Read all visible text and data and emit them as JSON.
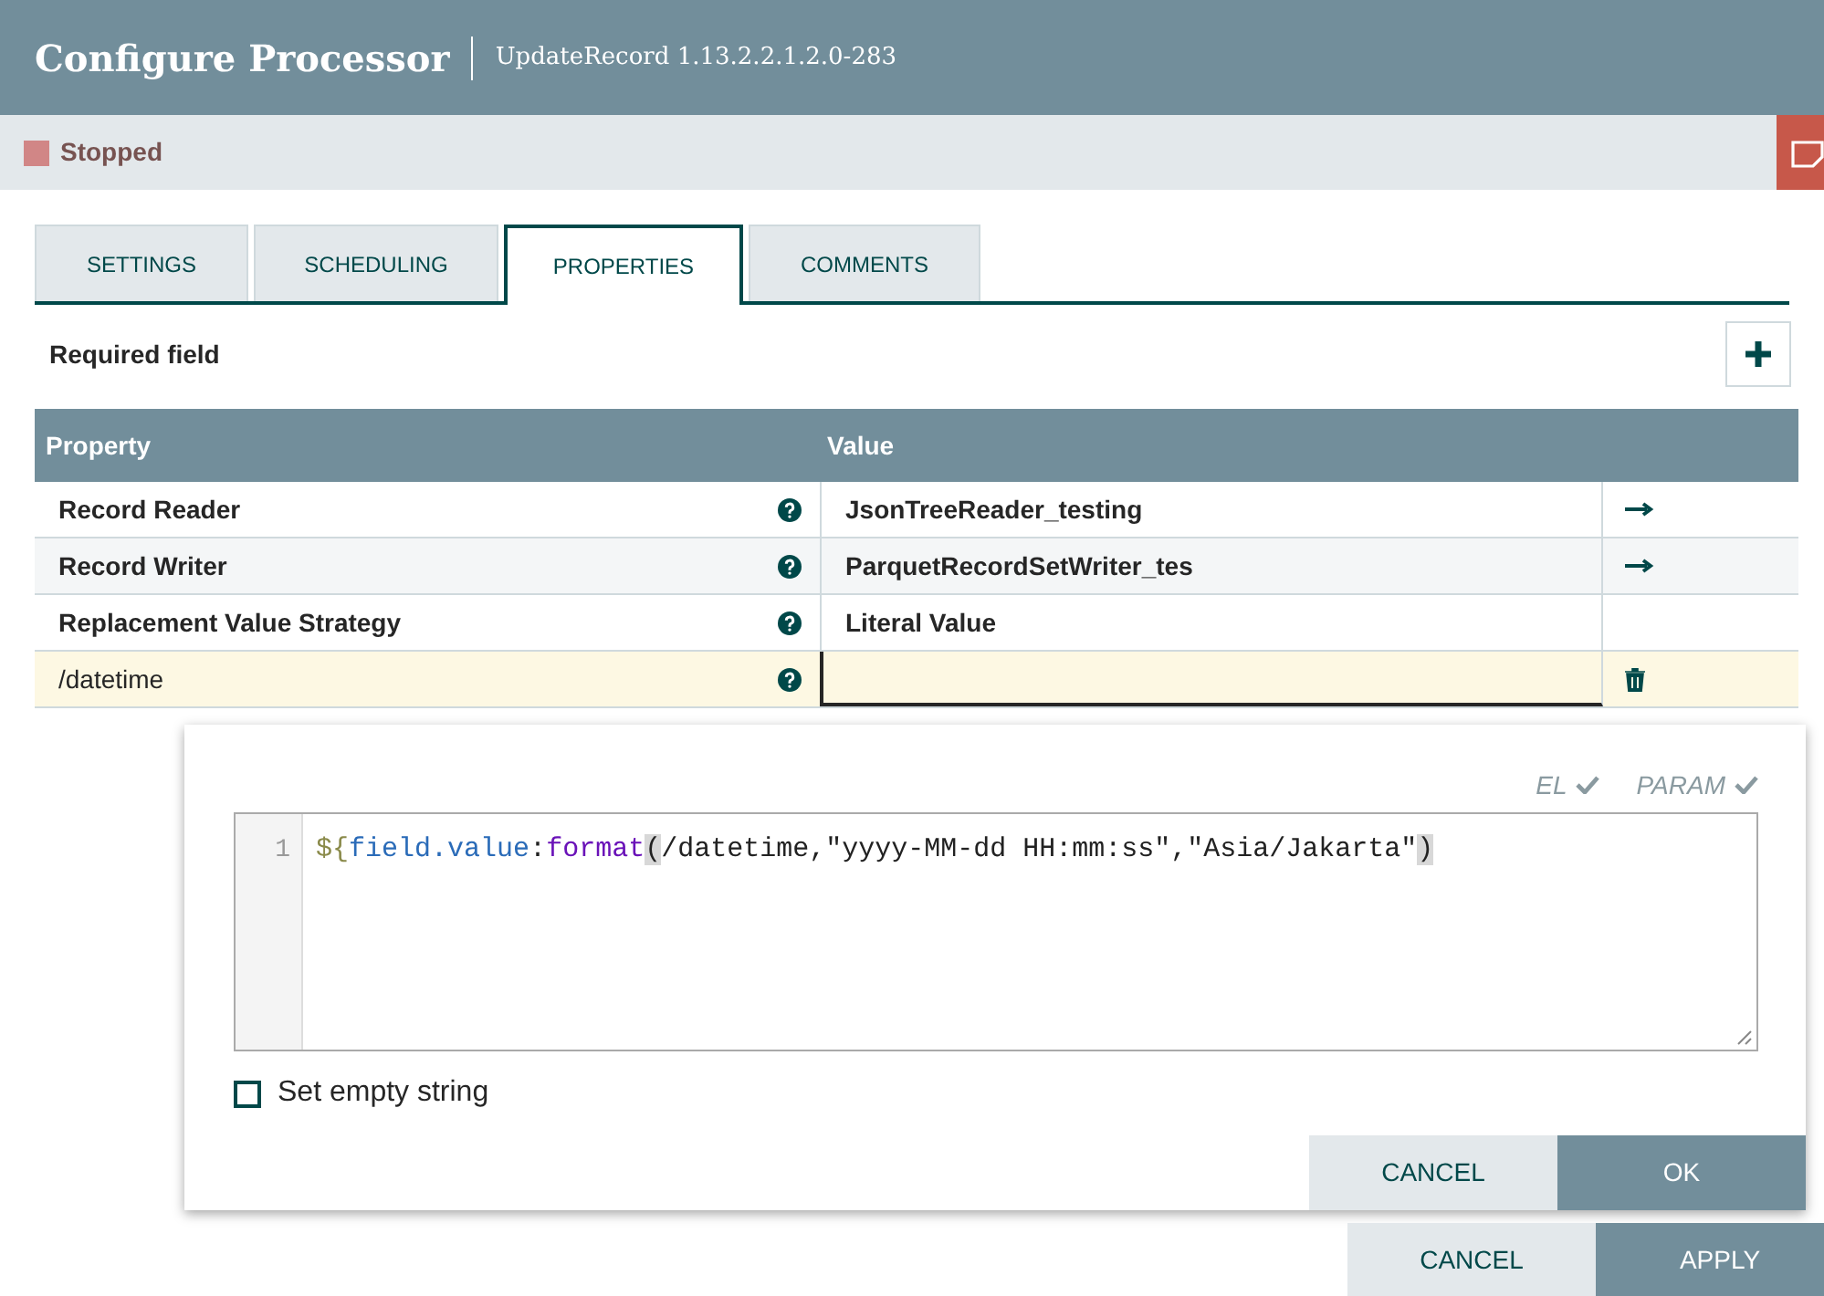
{
  "dialog": {
    "title": "Configure Processor",
    "subtitle": "UpdateRecord 1.13.2.2.1.2.0-283"
  },
  "status": {
    "label": "Stopped",
    "color": "#d18686"
  },
  "tabs": [
    {
      "label": "SETTINGS",
      "selected": false
    },
    {
      "label": "SCHEDULING",
      "selected": false
    },
    {
      "label": "PROPERTIES",
      "selected": true
    },
    {
      "label": "COMMENTS",
      "selected": false
    }
  ],
  "required_label": "Required field",
  "table": {
    "columns": [
      "Property",
      "Value"
    ],
    "rows": [
      {
        "property": "Record Reader",
        "value": "JsonTreeReader_testing",
        "required": true,
        "kind": "arrow",
        "editing": false
      },
      {
        "property": "Record Writer",
        "value": "ParquetRecordSetWriter_tes",
        "required": true,
        "kind": "arrow",
        "editing": false
      },
      {
        "property": "Replacement Value Strategy",
        "value": "Literal Value",
        "required": true,
        "kind": "plain",
        "editing": false
      },
      {
        "property": "/datetime",
        "value": "",
        "required": false,
        "kind": "delete",
        "editing": true
      }
    ]
  },
  "editor": {
    "flags": [
      "EL",
      "PARAM"
    ],
    "line_number": "1",
    "tokens": [
      {
        "kind": "punct",
        "text": "${"
      },
      {
        "kind": "name",
        "text": "field.value"
      },
      {
        "kind": "plain",
        "text": ":"
      },
      {
        "kind": "func",
        "text": "format"
      },
      {
        "kind": "bracket",
        "text": "("
      },
      {
        "kind": "plain",
        "text": "/datetime,\"yyyy-MM-dd HH:mm:ss\",\"Asia/Jakarta\""
      },
      {
        "kind": "bracket",
        "text": ")"
      }
    ],
    "empty_string": {
      "label": "Set empty string",
      "checked": false
    },
    "buttons": [
      {
        "label": "CANCEL",
        "kind": "secondary"
      },
      {
        "label": "OK",
        "kind": "primary"
      }
    ]
  },
  "footer_buttons": [
    {
      "label": "CANCEL",
      "kind": "secondary"
    },
    {
      "label": "APPLY",
      "kind": "primary"
    }
  ]
}
